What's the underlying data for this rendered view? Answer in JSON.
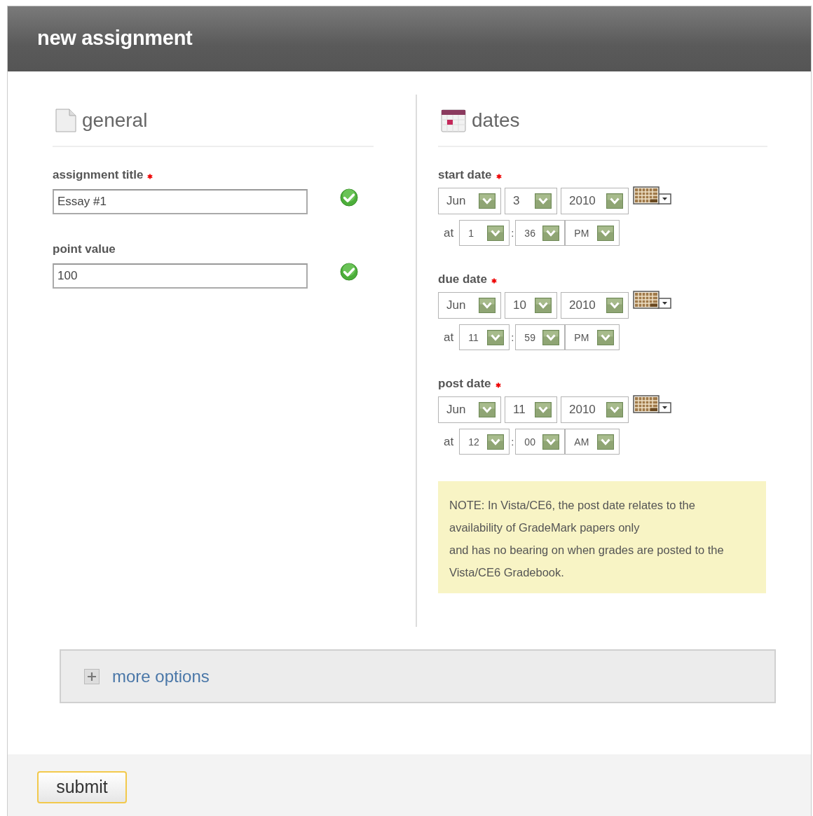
{
  "window": {
    "title": "new assignment"
  },
  "general": {
    "heading": "general",
    "fields": [
      {
        "label": "assignment title",
        "required": true,
        "value": "Essay #1",
        "valid": true
      },
      {
        "label": "point value",
        "required": false,
        "value": "100",
        "valid": true
      }
    ]
  },
  "dates": {
    "heading": "dates",
    "items": [
      {
        "label": "start date",
        "required": true,
        "month": "Jun",
        "day": "3",
        "year": "2010",
        "at_label": "at",
        "hour": "1",
        "separator": ":",
        "minute": "36",
        "ampm": "PM"
      },
      {
        "label": "due date",
        "required": true,
        "month": "Jun",
        "day": "10",
        "year": "2010",
        "at_label": "at",
        "hour": "11",
        "separator": ":",
        "minute": "59",
        "ampm": "PM"
      },
      {
        "label": "post date",
        "required": true,
        "month": "Jun",
        "day": "11",
        "year": "2010",
        "at_label": "at",
        "hour": "12",
        "separator": ":",
        "minute": "00",
        "ampm": "AM"
      }
    ],
    "note": [
      "NOTE: In Vista/CE6, the post date relates to the availability of GradeMark papers only",
      "and has no bearing on when grades are posted to the Vista/CE6 Gradebook."
    ]
  },
  "more_options": {
    "label": "more options",
    "expanded": false
  },
  "submit": {
    "label": "submit"
  }
}
